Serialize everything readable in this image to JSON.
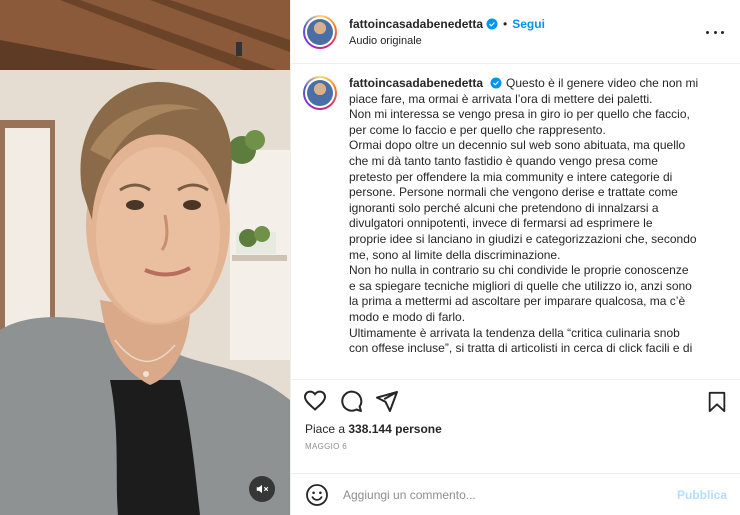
{
  "header": {
    "username": "fattoincasadabenedetta",
    "separator": "•",
    "follow_label": "Segui",
    "audio": "Audio originale"
  },
  "caption": {
    "username": "fattoincasadabenedetta",
    "lines": [
      "Questo è il genere video che non mi",
      "piace fare, ma ormai è arrivata l’ora di mettere dei paletti.",
      "Non mi interessa se vengo presa in giro io per quello che faccio,",
      "per come lo faccio e per quello che rappresento.",
      "Ormai dopo oltre un decennio sul web sono abituata, ma quello",
      "che mi dà tanto tanto fastidio è quando vengo presa come",
      "pretesto per offendere la mia community e intere categorie di",
      "persone. Persone normali che vengono derise e trattate come",
      "ignoranti solo perché alcuni che pretendono di innalzarsi a",
      "divulgatori onnipotenti, invece di fermarsi ad esprimere le",
      "proprie idee si lanciano in giudizi e categorizzazioni che, secondo",
      "me, sono al limite della discriminazione.",
      "Non ho nulla in contrario su chi condivide le proprie conoscenze",
      "e sa spiegare tecniche migliori di quelle che utilizzo io, anzi sono",
      "la prima a mettermi ad ascoltare per imparare qualcosa, ma c’è",
      "modo e modo di farlo.",
      "Ultimamente è arrivata la tendenza della “critica culinaria snob",
      "con offese incluse”, si tratta di articolisti in cerca di click facili e di"
    ]
  },
  "likes": {
    "prefix": "Piace a",
    "count": "338.144",
    "suffix": "persone"
  },
  "date": "MAGGIO 6",
  "comment": {
    "placeholder": "Aggiungi un commento...",
    "publish_label": "Pubblica"
  },
  "icons": {
    "like": "heart-icon",
    "comment": "comment-icon",
    "share": "share-icon",
    "save": "bookmark-icon",
    "emoji": "emoji-icon",
    "mute": "speaker-muted-icon",
    "more": "more-options-icon",
    "verified": "verified-badge-icon"
  },
  "colors": {
    "follow": "#0095f6",
    "verified": "#0095f6",
    "publish_disabled": "#b2dffc",
    "muted_text": "#8e8e8e"
  }
}
